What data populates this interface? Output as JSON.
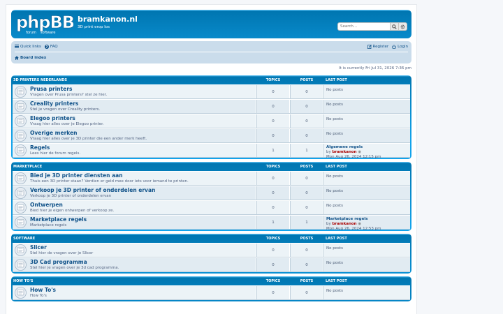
{
  "site": {
    "title": "bramkanon.nl",
    "description": "3D print erop los",
    "logo_text": "phpBB",
    "logo_sub": "forum software"
  },
  "search": {
    "placeholder": "Search…"
  },
  "nav": {
    "quick_links": "Quick links",
    "faq": "FAQ",
    "register": "Register",
    "login": "Login",
    "board_index": "Board index"
  },
  "timeline": "It is currently Fri Jul 31, 2026 7:36 pm",
  "columns": {
    "topics": "Topics",
    "posts": "Posts",
    "last_post": "Last post"
  },
  "categories": [
    {
      "name": "3D printers Nederlands",
      "forums": [
        {
          "title": "Prusa printers",
          "desc": "Vragen over Prusa printers? stel ze hier.",
          "topics": "0",
          "posts": "0",
          "last": {
            "type": "none",
            "text": "No posts"
          }
        },
        {
          "title": "Creality printers",
          "desc": "Stel je vragen over Creality printers.",
          "topics": "0",
          "posts": "0",
          "last": {
            "type": "none",
            "text": "No posts"
          }
        },
        {
          "title": "Elegoo printers",
          "desc": "Vraag hier alles over je Elegoo printer.",
          "topics": "0",
          "posts": "0",
          "last": {
            "type": "none",
            "text": "No posts"
          }
        },
        {
          "title": "Overige merken",
          "desc": "Vraag hier alles over je 3D printer die een ander merk heeft.",
          "topics": "0",
          "posts": "0",
          "last": {
            "type": "none",
            "text": "No posts"
          }
        },
        {
          "title": "Regels",
          "desc": "Lees hier de forum regels.",
          "topics": "1",
          "posts": "1",
          "last": {
            "type": "post",
            "title": "Algemene regels",
            "by": "by",
            "author": "bramkanon",
            "date": "Mon Aug 26, 2024 12:15 pm"
          }
        }
      ]
    },
    {
      "name": "Marketplace",
      "forums": [
        {
          "title": "Bied je 3D printer diensten aan",
          "desc": "Thuis een 3D printer staan? Verdien er geld mee door iets voor iemand te printen.",
          "topics": "0",
          "posts": "0",
          "last": {
            "type": "none",
            "text": "No posts"
          }
        },
        {
          "title": "Verkoop je 3D printer of onderdelen ervan",
          "desc": "Verkoop je 3D printer of onderdelen ervan",
          "topics": "0",
          "posts": "0",
          "last": {
            "type": "none",
            "text": "No posts"
          }
        },
        {
          "title": "Ontwerpen",
          "desc": "Bied hier je eigen ontwerpen of verkoop ze.",
          "topics": "0",
          "posts": "0",
          "last": {
            "type": "none",
            "text": "No posts"
          }
        },
        {
          "title": "Marketplace regels",
          "desc": "Marketplace regels",
          "topics": "1",
          "posts": "1",
          "last": {
            "type": "post",
            "title": "Marketplace regels",
            "by": "by",
            "author": "bramkanon",
            "date": "Mon Aug 26, 2024 12:53 pm"
          }
        }
      ]
    },
    {
      "name": "Software",
      "forums": [
        {
          "title": "Slicer",
          "desc": "Stel hier de vragen over je Slicer",
          "topics": "0",
          "posts": "0",
          "last": {
            "type": "none",
            "text": "No posts"
          }
        },
        {
          "title": "3D Cad programma",
          "desc": "Stel hier je vragen over je 3d cad programma.",
          "topics": "0",
          "posts": "0",
          "last": {
            "type": "none",
            "text": "No posts"
          }
        }
      ]
    },
    {
      "name": "How to's",
      "forums": [
        {
          "title": "How To's",
          "desc": "How To's",
          "topics": "0",
          "posts": "0",
          "last": {
            "type": "none",
            "text": "No posts"
          }
        }
      ]
    }
  ]
}
